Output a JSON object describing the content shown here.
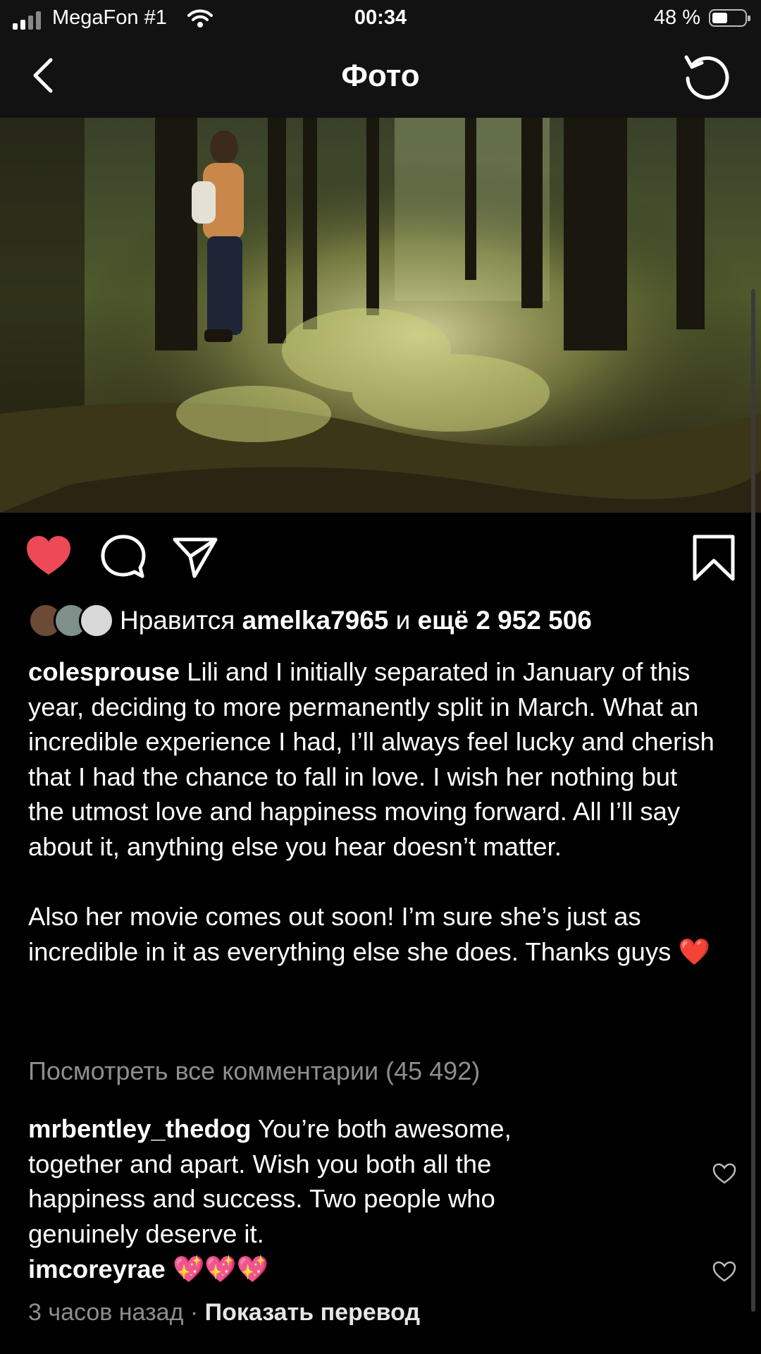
{
  "status_bar": {
    "carrier": "MegaFon #1",
    "time": "00:34",
    "battery_percent": "48 %"
  },
  "nav": {
    "title": "Фото",
    "back_icon": "chevron-left-icon",
    "refresh_icon": "refresh-icon"
  },
  "post": {
    "liked": true,
    "like_color": "#ED4956",
    "likes": {
      "prefix": "Нравится",
      "user": "amelka7965",
      "conj": "и",
      "more": "ещё 2 952 506"
    },
    "caption": {
      "username": "colesprouse",
      "paragraph1": "Lili and I initially separated in January of this year, deciding to more permanently split in March. What an incredible experience I had, I’ll always feel lucky and cherish that I had the chance to fall in love. I wish her nothing but the utmost love and happiness moving forward. All I’ll say about it, anything else you hear doesn’t matter.",
      "paragraph2": "Also her movie comes out soon! I’m sure she’s just as incredible in it as everything else she does. Thanks guys ❤️"
    },
    "view_all_comments": "Посмотреть все комментарии (45 492)",
    "comments": [
      {
        "username": "mrbentley_thedog",
        "text": "You’re both awesome, together and apart. Wish you both all the happiness and success. Two people who genuinely deserve it."
      },
      {
        "username": "imcoreyrae",
        "text": "💖💖💖"
      }
    ],
    "time_ago": "3 часов назад",
    "separator": "·",
    "show_translation": "Показать перевод"
  }
}
